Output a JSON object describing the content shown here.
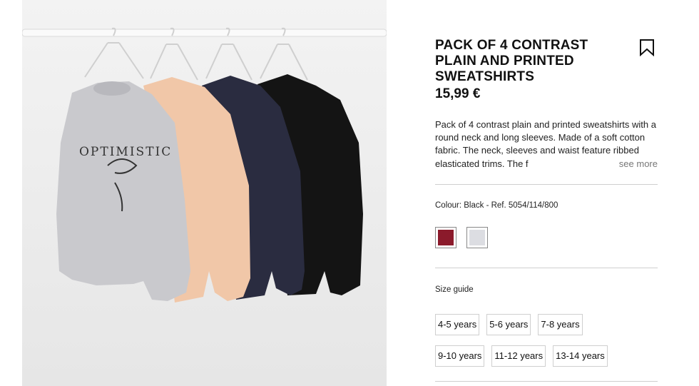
{
  "product": {
    "title": "PACK OF 4 CONTRAST PLAIN AND PRINTED SWEATSHIRTS",
    "price": "15,99 €",
    "description": "Pack of 4 contrast plain and printed sweatshirts with a round neck and long sleeves. Made of a soft cotton fabric. The neck, sleeves and waist feature ribbed elasticated trims. The f",
    "see_more": "see more",
    "print_text": "OPTIMISTIC"
  },
  "colour": {
    "label": "Colour: Black - Ref. 5054/114/800",
    "swatches": [
      {
        "name": "burgundy",
        "color": "#8b1a2b"
      },
      {
        "name": "light-grey",
        "color": "#dcdde2"
      }
    ]
  },
  "size": {
    "guide_label": "Size guide",
    "rows": [
      [
        "4-5 years",
        "5-6 years",
        "7-8 years"
      ],
      [
        "9-10 years",
        "11-12 years",
        "13-14 years"
      ]
    ]
  },
  "icons": {
    "bookmark": "bookmark-icon"
  },
  "colors": {
    "sweatshirt_grey": "#c9c9cd",
    "sweatshirt_peach": "#f1c7a8",
    "sweatshirt_navy": "#2a2c40",
    "sweatshirt_black": "#141414"
  }
}
